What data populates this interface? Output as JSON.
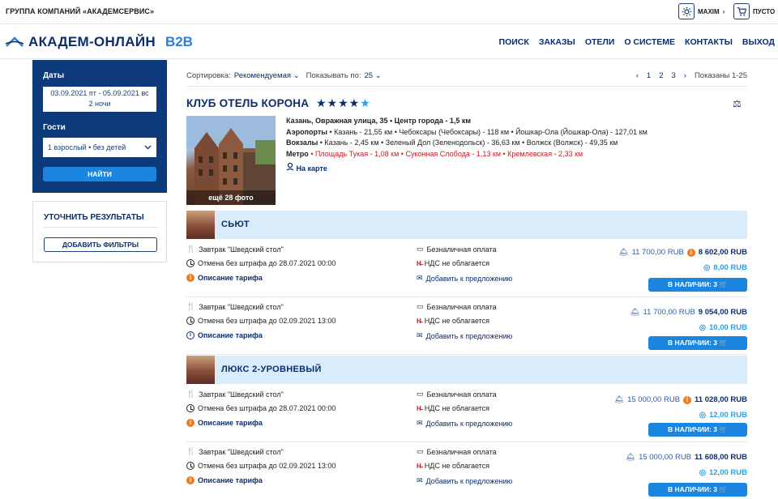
{
  "topbar": {
    "group_name": "ГРУППА КОМПАНИЙ «АКАДЕМСЕРВИС»",
    "user_label": "MAXIM",
    "cart_label": "ПУСТО"
  },
  "header": {
    "logo_text": "АКАДЕМ-ОНЛАЙН",
    "logo_suffix": "B2B",
    "nav": [
      "ПОИСК",
      "ЗАКАЗЫ",
      "ОТЕЛИ",
      "О СИСТЕМЕ",
      "КОНТАКТЫ",
      "ВЫХОД"
    ]
  },
  "search": {
    "dates_label": "Даты",
    "dates_line1": "03.09.2021 пт - 05.09.2021 вс",
    "dates_line2": "2 ночи",
    "guests_label": "Гости",
    "guests_value": "1 взрослый • без детей",
    "find_button": "НАЙТИ"
  },
  "refine": {
    "title": "УТОЧНИТЬ РЕЗУЛЬТАТЫ",
    "add_filters": "ДОБАВИТЬ ФИЛЬТРЫ"
  },
  "sortbar": {
    "sort_label": "Сортировка:",
    "sort_value": "Рекомендуемая",
    "show_label": "Показывать по:",
    "show_value": "25",
    "pages": [
      "1",
      "2",
      "3"
    ],
    "shown": "Показаны 1-25"
  },
  "hotel": {
    "name": "КЛУБ ОТЕЛЬ КОРОНА",
    "stars": 4.5,
    "photo_caption": "ещё 28 фото",
    "address": "Казань, Овражная улица, 35 • Центр города - 1,5 км",
    "airports_label": "Аэропорты",
    "airports": "• Казань - 21,55 км • Чебоксары (Чебоксары) - 118 км • Йошкар-Ола (Йошкар-Ола) - 127,01 км",
    "stations_label": "Вокзалы",
    "stations": "• Казань - 2,45 км • Зеленый Дол (Зеленодольск) - 36,63 км • Волжск (Волжск) - 49,35 км",
    "metro_label": "Метро",
    "metro": "• Площадь Тукая - 1,08 км • Суконная Слобода - 1,13 км • Кремлевская - 2,33 км",
    "on_map": "На карте"
  },
  "rooms": [
    {
      "title": "СЬЮТ",
      "tariffs": [
        {
          "meal": "Завтрак \"Шведский стол\"",
          "cancel": "Отмена без штрафа до 28.07.2021 00:00",
          "desc": "Описание тарифа",
          "desc_icon": "orange",
          "payment": "Безналичная оплата",
          "vat": "НДС не облагается",
          "offer": "Добавить к предложению",
          "old_price": "11 700,00 RUB",
          "new_price": "8 602,00 RUB",
          "price_icon": "orange",
          "bonus": "8,00 RUB",
          "avail": "В НАЛИЧИИ: 3"
        },
        {
          "meal": "Завтрак \"Шведский стол\"",
          "cancel": "Отмена без штрафа до 02.09.2021 13:00",
          "desc": "Описание тарифа",
          "desc_icon": "blue",
          "payment": "Безналичная оплата",
          "vat": "НДС не облагается",
          "offer": "Добавить к предложению",
          "old_price": "11 700,00 RUB",
          "new_price": "9 054,00 RUB",
          "price_icon": "none",
          "bonus": "10,00 RUB",
          "avail": "В НАЛИЧИИ: 3"
        }
      ]
    },
    {
      "title": "ЛЮКС 2-УРОВНЕВЫЙ",
      "tariffs": [
        {
          "meal": "Завтрак \"Шведский стол\"",
          "cancel": "Отмена без штрафа до 28.07.2021 00:00",
          "desc": "Описание тарифа",
          "desc_icon": "orange",
          "payment": "Безналичная оплата",
          "vat": "НДС не облагается",
          "offer": "Добавить к предложению",
          "old_price": "15 000,00 RUB",
          "new_price": "11 028,00 RUB",
          "price_icon": "orange",
          "bonus": "12,00 RUB",
          "avail": "В НАЛИЧИИ: 3"
        },
        {
          "meal": "Завтрак \"Шведский стол\"",
          "cancel": "Отмена без штрафа до 02.09.2021 13:00",
          "desc": "Описание тарифа",
          "desc_icon": "blue",
          "payment": "Безналичная оплата",
          "vat": "НДС не облагается",
          "offer": "Добавить к предложению",
          "old_price": "15 000,00 RUB",
          "new_price": "11 608,00 RUB",
          "price_icon": "none",
          "bonus": "12,00 RUB",
          "avail": "В НАЛИЧИИ: 3"
        }
      ]
    }
  ]
}
